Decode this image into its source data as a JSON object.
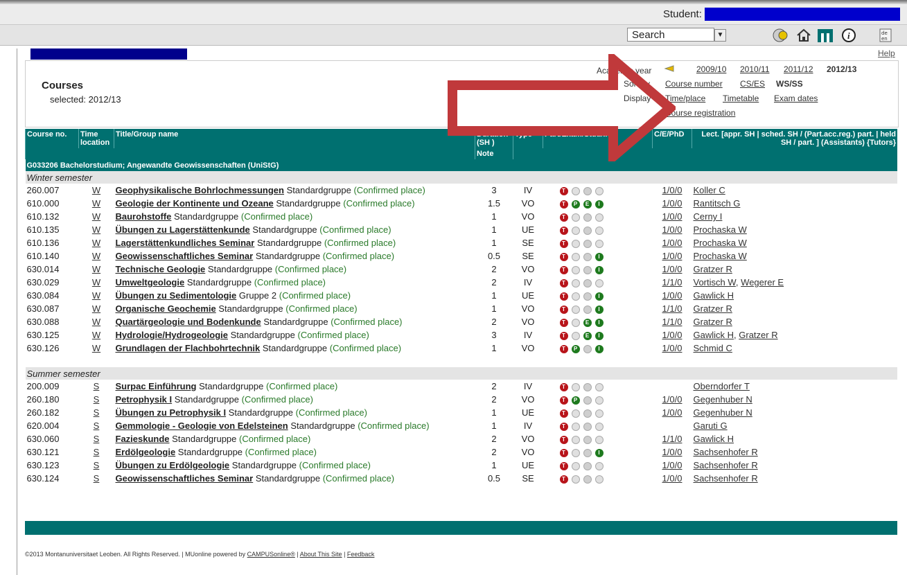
{
  "topbar": {
    "student_label": "Student:",
    "search_value": "Search"
  },
  "colors": {
    "teal": "#007070",
    "red_arrow": "#c0393b",
    "blue_bar": "#00008c",
    "confirmed_green": "#2a7a2a"
  },
  "icons": [
    "exam-icon",
    "home-icon",
    "mu-logo-icon",
    "info-icon",
    "language-icon"
  ],
  "help_label": "Help",
  "header": {
    "title": "Courses",
    "selected": "selected: 2012/13",
    "academic_year_label": "Academic year",
    "years": [
      "2009/10",
      "2010/11",
      "2011/12",
      "2012/13"
    ],
    "sort_label": "Sort by",
    "sort_options": [
      "Course number",
      "CS/ES",
      "WS/SS"
    ],
    "display_label": "Display",
    "display_options": [
      "Time/place",
      "Timetable",
      "Exam dates"
    ],
    "registration_link": "Course registration"
  },
  "columns": {
    "course_no": "Course no.",
    "time_location": "Time location",
    "title": "Title/Group name",
    "duration": "Duration (SH )",
    "note": "Note",
    "type": "Type",
    "part_exam": "Part/Exam/Stud/Info",
    "cep": "C/E/PhD",
    "lecturer": "Lect. [appr. SH | sched. SH / (Part.acc.reg.) part. | held SH / part. ] (Assistants) {Tutors}"
  },
  "group_label": "G033206 Bachelorstudium; Angewandte Geowissenschaften (UniStG)",
  "confirmed_text": "(Confirmed place)",
  "winter": {
    "label": "Winter semester",
    "rows": [
      {
        "no": "260.007",
        "tl": "W",
        "title": "Geophysikalische Bohrlochmessungen",
        "group": "Standardgruppe",
        "dur": "3",
        "type": "IV",
        "icons": "rggg",
        "cep": "1/0/0",
        "lect": [
          "Koller C"
        ]
      },
      {
        "no": "610.000",
        "tl": "W",
        "title": "Geologie der Kontinente und Ozeane",
        "group": "Standardgruppe",
        "dur": "1.5",
        "type": "VO",
        "icons": "rGGG",
        "cep": "1/0/0",
        "lect": [
          "Rantitsch G"
        ]
      },
      {
        "no": "610.132",
        "tl": "W",
        "title": "Baurohstoffe",
        "group": "Standardgruppe",
        "dur": "1",
        "type": "VO",
        "icons": "rggg",
        "cep": "1/0/0",
        "lect": [
          "Cerny I"
        ]
      },
      {
        "no": "610.135",
        "tl": "W",
        "title": "Übungen zu Lagerstättenkunde",
        "group": "Standardgruppe",
        "dur": "1",
        "type": "UE",
        "icons": "rggg",
        "cep": "1/0/0",
        "lect": [
          "Prochaska W"
        ]
      },
      {
        "no": "610.136",
        "tl": "W",
        "title": "Lagerstättenkundliches Seminar",
        "group": "Standardgruppe",
        "dur": "1",
        "type": "SE",
        "icons": "rggg",
        "cep": "1/0/0",
        "lect": [
          "Prochaska W"
        ]
      },
      {
        "no": "610.140",
        "tl": "W",
        "title": "Geowissenschaftliches Seminar",
        "group": "Standardgruppe",
        "dur": "0.5",
        "type": "SE",
        "icons": "rggG",
        "cep": "1/0/0",
        "lect": [
          "Prochaska W"
        ]
      },
      {
        "no": "630.014",
        "tl": "W",
        "title": "Technische Geologie",
        "group": "Standardgruppe",
        "dur": "2",
        "type": "VO",
        "icons": "rggG",
        "cep": "1/0/0",
        "lect": [
          "Gratzer R"
        ]
      },
      {
        "no": "630.029",
        "tl": "W",
        "title": "Umweltgeologie",
        "group": "Standardgruppe",
        "dur": "2",
        "type": "IV",
        "icons": "rggg",
        "cep": "1/1/0",
        "lect": [
          "Vortisch W",
          "Wegerer E"
        ]
      },
      {
        "no": "630.084",
        "tl": "W",
        "title": "Übungen zu Sedimentologie",
        "group": "Gruppe 2",
        "dur": "1",
        "type": "UE",
        "icons": "rggG",
        "cep": "1/0/0",
        "lect": [
          "Gawlick H"
        ]
      },
      {
        "no": "630.087",
        "tl": "W",
        "title": "Organische Geochemie",
        "group": "Standardgruppe",
        "dur": "1",
        "type": "VO",
        "icons": "rggG",
        "cep": "1/1/0",
        "lect": [
          "Gratzer R"
        ]
      },
      {
        "no": "630.088",
        "tl": "W",
        "title": "Quartärgeologie und Bodenkunde",
        "group": "Standardgruppe",
        "dur": "2",
        "type": "VO",
        "icons": "rgGG",
        "cep": "1/1/0",
        "lect": [
          "Gratzer R"
        ]
      },
      {
        "no": "630.125",
        "tl": "W",
        "title": "Hydrologie/Hydrogeologie",
        "group": "Standardgruppe",
        "dur": "3",
        "type": "IV",
        "icons": "rgGG",
        "cep": "1/0/0",
        "lect": [
          "Gawlick H",
          "Gratzer R"
        ]
      },
      {
        "no": "630.126",
        "tl": "W",
        "title": "Grundlagen der Flachbohrtechnik",
        "group": "Standardgruppe",
        "dur": "1",
        "type": "VO",
        "icons": "rGgG",
        "cep": "1/0/0",
        "lect": [
          "Schmid C"
        ]
      }
    ]
  },
  "summer": {
    "label": "Summer semester",
    "rows": [
      {
        "no": "200.009",
        "tl": "S",
        "title": "Surpac Einführung",
        "group": "Standardgruppe",
        "dur": "2",
        "type": "IV",
        "icons": "rggg",
        "cep": "",
        "lect": [
          "Oberndorfer T"
        ]
      },
      {
        "no": "260.180",
        "tl": "S",
        "title": "Petrophysik I",
        "group": "Standardgruppe",
        "dur": "2",
        "type": "VO",
        "icons": "rGgg",
        "cep": "1/0/0",
        "lect": [
          "Gegenhuber N"
        ]
      },
      {
        "no": "260.182",
        "tl": "S",
        "title": "Übungen zu Petrophysik I",
        "group": "Standardgruppe",
        "dur": "1",
        "type": "UE",
        "icons": "rggg",
        "cep": "1/0/0",
        "lect": [
          "Gegenhuber N"
        ]
      },
      {
        "no": "620.004",
        "tl": "S",
        "title": "Gemmologie - Geologie von Edelsteinen",
        "group": "Standardgruppe",
        "dur": "1",
        "type": "IV",
        "icons": "rggg",
        "cep": "",
        "lect": [
          "Garuti G"
        ]
      },
      {
        "no": "630.060",
        "tl": "S",
        "title": "Fazieskunde",
        "group": "Standardgruppe",
        "dur": "2",
        "type": "VO",
        "icons": "rggg",
        "cep": "1/1/0",
        "lect": [
          "Gawlick H"
        ]
      },
      {
        "no": "630.121",
        "tl": "S",
        "title": "Erdölgeologie",
        "group": "Standardgruppe",
        "dur": "2",
        "type": "VO",
        "icons": "rggG",
        "cep": "1/0/0",
        "lect": [
          "Sachsenhofer R"
        ]
      },
      {
        "no": "630.123",
        "tl": "S",
        "title": "Übungen zu Erdölgeologie",
        "group": "Standardgruppe",
        "dur": "1",
        "type": "UE",
        "icons": "rggg",
        "cep": "1/0/0",
        "lect": [
          "Sachsenhofer R"
        ]
      },
      {
        "no": "630.124",
        "tl": "S",
        "title": "Geowissenschaftliches Seminar",
        "group": "Standardgruppe",
        "dur": "0.5",
        "type": "SE",
        "icons": "rggg",
        "cep": "1/0/0",
        "lect": [
          "Sachsenhofer R"
        ]
      }
    ]
  },
  "footer": {
    "copyright": "©2013 Montanuniversitaet Leoben. All Rights Reserved. | MUonline powered by",
    "campus_link": "CAMPUSonline®",
    "about_link": "About This Site",
    "feedback_link": "Feedback"
  }
}
